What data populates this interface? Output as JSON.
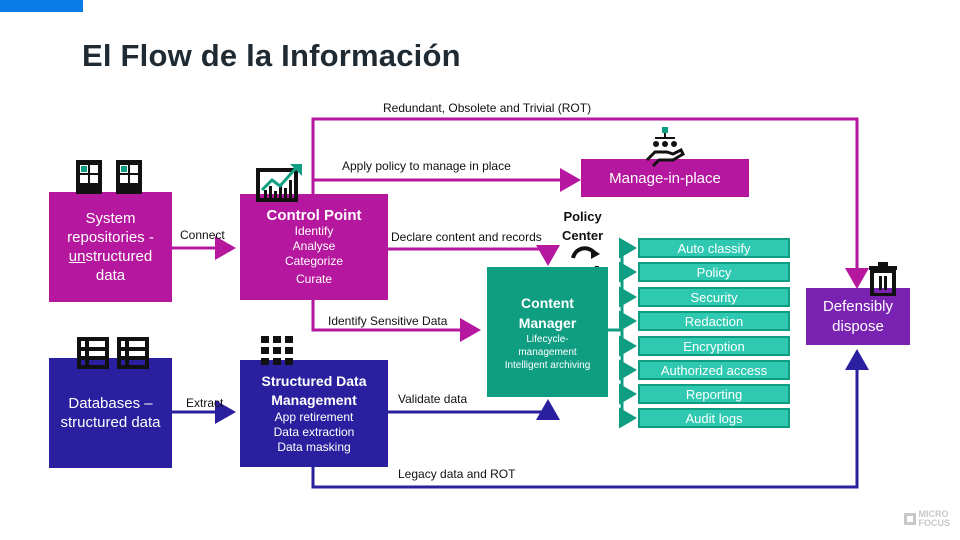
{
  "title": "El Flow de la Información",
  "colors": {
    "accent_bar": "#0a7ae6",
    "magenta": "#b5179e",
    "navy": "#2a1f9e",
    "green": "#0f9e82",
    "teal_feature": "#2ec9b0",
    "purple": "#7a22b2"
  },
  "flow_labels": {
    "rot": "Redundant, Obsolete and Trivial (ROT)",
    "apply_policy": "Apply policy to manage in place",
    "connect": "Connect",
    "extract": "Extract",
    "declare": "Declare content and records",
    "identify_sensitive": "Identify Sensitive Data",
    "validate": "Validate data",
    "legacy": "Legacy data and ROT"
  },
  "nodes": {
    "system_repos": {
      "line1": "System",
      "line2": "repositories -",
      "line3_underlined": "un",
      "line3_rest": "structured",
      "line4": "data"
    },
    "databases": {
      "line1": "Databases –",
      "line2": "structured data"
    },
    "control_point": {
      "title": "Control Point",
      "items": [
        "Identify",
        "Analyse",
        "Categorize",
        "Curate"
      ]
    },
    "structured_mgmt": {
      "title1": "Structured Data",
      "title2": "Management",
      "items": [
        "App retirement",
        "Data extraction",
        "Data masking"
      ]
    },
    "manage_in_place": {
      "label": "Manage-in-place"
    },
    "policy_center": {
      "line1": "Policy",
      "line2": "Center"
    },
    "content_manager": {
      "title1": "Content",
      "title2": "Manager",
      "items": [
        "Lifecycle-",
        "management",
        "Intelligent archiving"
      ]
    },
    "defensibly_dispose": {
      "line1": "Defensibly",
      "line2": "dispose"
    }
  },
  "features": [
    "Auto classify",
    "Policy",
    "Security",
    "Redaction",
    "Encryption",
    "Authorized access",
    "Reporting",
    "Audit logs"
  ],
  "icons": {
    "server": "server-icon",
    "database": "database-icon",
    "chart": "trending-chart-icon",
    "grid": "grid-icon",
    "hand": "hand-network-icon",
    "cycle": "refresh-cycle-icon",
    "trash": "trash-icon"
  },
  "logo": {
    "line1": "MICRO",
    "line2": "FOCUS"
  }
}
